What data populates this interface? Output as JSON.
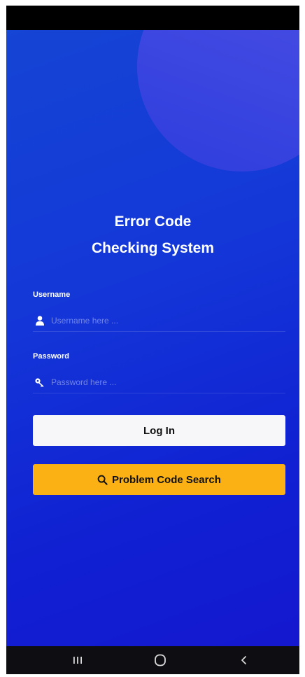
{
  "app": {
    "title_line1": "Error Code",
    "title_line2": "Checking System"
  },
  "form": {
    "username": {
      "label": "Username",
      "value": "",
      "placeholder": "Username here ...",
      "icon": "user-icon"
    },
    "password": {
      "label": "Password",
      "value": "",
      "placeholder": "Password here ...",
      "icon": "key-icon"
    }
  },
  "buttons": {
    "login_label": "Log In",
    "search_label": "Problem Code Search",
    "search_icon": "search-icon"
  },
  "colors": {
    "background": "#1437d8",
    "login_button": "#f7f7f9",
    "search_button": "#fbb113",
    "text": "#ffffff"
  },
  "nav": {
    "recents_icon": "recents-icon",
    "home_icon": "home-icon",
    "back_icon": "back-icon"
  }
}
